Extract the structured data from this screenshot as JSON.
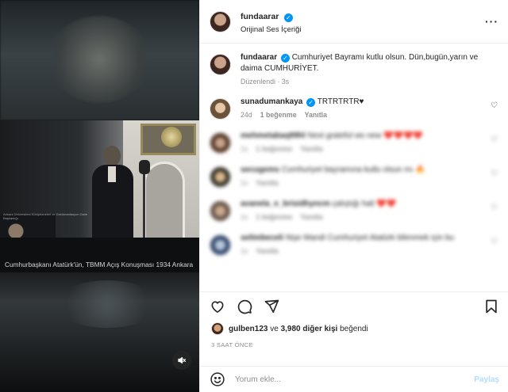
{
  "post": {
    "author": "fundaarar",
    "audio": "Orijinal Ses İçeriği",
    "caption_author": "fundaarar",
    "caption_text": "Cumhuriyet Bayramı kutlu olsun. Dün,bugün,yarın ve daima CUMHURİYET.",
    "caption_edited": "Düzenlendi",
    "caption_age": "3s",
    "video_caption": "Cumhurbaşkanı Atatürk'ün, TBMM Açış Konuşması 1934 Ankara",
    "video_watermark": "Ankara Üniversitesi Kütüphaneleri ve Dokümantasyon Daire Başkanlığı"
  },
  "comments": [
    {
      "user": "sunadumankaya",
      "verified": true,
      "text": "TRTRTRTR♥",
      "age": "24d",
      "likes": "1 beğenme",
      "reply": "Yanıtla",
      "blurred": false
    },
    {
      "user": "mehmetabaq99hl",
      "verified": false,
      "text": "Next grateful ws new ❤️❤️❤️❤️",
      "age": "1s",
      "likes": "1 beğenme",
      "reply": "Yanıtla",
      "blurred": true
    },
    {
      "user": "secugems",
      "verified": false,
      "text": "Cumhuriyet bayramına kutlu olsun mı 🔥",
      "age": "1s",
      "likes": "",
      "reply": "Yanıtla",
      "blurred": true
    },
    {
      "user": "avanela_e_brisidhyncm",
      "verified": false,
      "text": "çalıştığı hali ❤️❤️",
      "age": "1s",
      "likes": "1 beğenme",
      "reply": "Yanıtla",
      "blurred": true
    },
    {
      "user": "selimbeceli",
      "verified": false,
      "text": "Nişe Mandi Cumhuriyet Atatürk bilenmek için bu",
      "age": "1s",
      "likes": "",
      "reply": "Yanıtla",
      "blurred": true
    }
  ],
  "likes": {
    "first_user": "gulben123",
    "connector": "ve",
    "others": "3,980 diğer kişi",
    "suffix": "beğendi"
  },
  "timestamp": "3 SAAT ÖNCE",
  "composer": {
    "placeholder": "Yorum ekle...",
    "share_label": "Paylaş"
  },
  "colors": {
    "verified_blue": "#0095f6",
    "share_disabled": "#b3dbff",
    "meta_gray": "#8e8e8e"
  }
}
